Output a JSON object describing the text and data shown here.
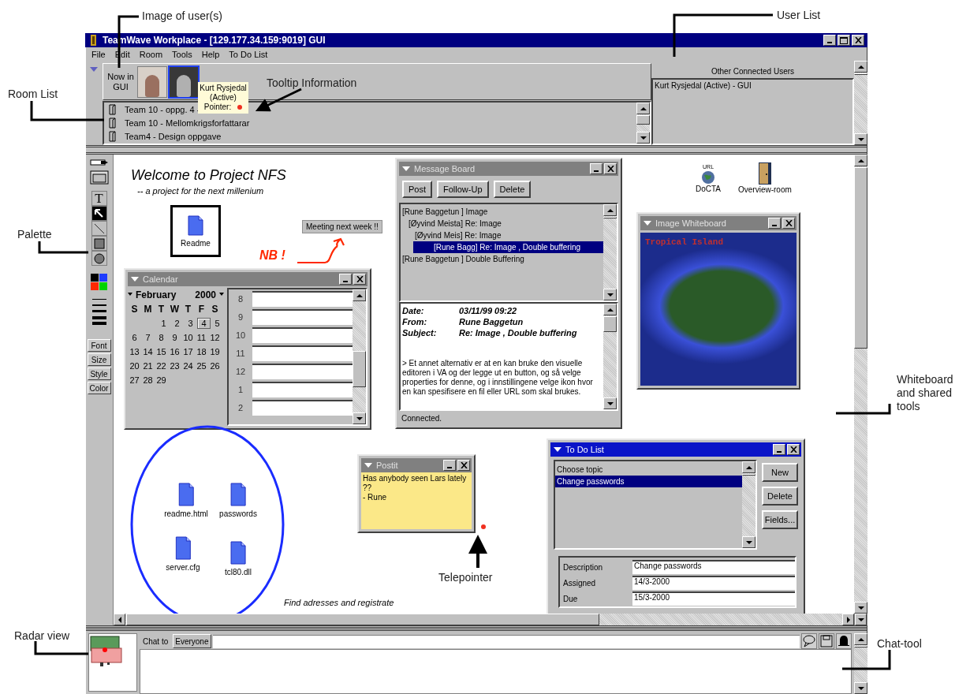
{
  "annotations": [
    {
      "text": "Image of user(s)"
    },
    {
      "text": "User List"
    },
    {
      "text": "Tooltip Information"
    },
    {
      "text": "Room List"
    },
    {
      "text": "Palette"
    },
    {
      "text": "Whiteboard and shared tools"
    },
    {
      "text": "Telepointer"
    },
    {
      "text": "Radar view"
    },
    {
      "text": "Chat-tool"
    }
  ],
  "window": {
    "title": "TeamWave Workplace - [129.177.34.159:9019] GUI"
  },
  "menu": [
    "File",
    "Edit",
    "Room",
    "Tools",
    "Help",
    "To Do List"
  ],
  "now_in": {
    "label": "Now in GUI",
    "users": [
      {
        "selected": false
      },
      {
        "selected": true
      }
    ]
  },
  "tooltip": {
    "name": "Kurt Rysjedal",
    "status": "(Active)",
    "pointer_label": "Pointer:"
  },
  "rooms": [
    "Team 10 - oppg. 4 -",
    "Team 10 - Mellomkrigsforfattarar",
    "Team4 - Design oppgave"
  ],
  "user_list": {
    "header": "Other Connected Users",
    "users": [
      "Kurt Rysjedal (Active) - GUI"
    ]
  },
  "palette": {
    "tools": [
      {
        "kind": "text",
        "label": "T",
        "selected": false
      },
      {
        "kind": "arrow",
        "selected": true
      },
      {
        "kind": "line",
        "selected": false
      },
      {
        "kind": "rect",
        "selected": false
      },
      {
        "kind": "oval",
        "selected": false
      }
    ],
    "colors": [
      {
        "color": "#000000"
      },
      {
        "color": "#1e3cff"
      },
      {
        "color": "#ff2800"
      },
      {
        "color": "#00d400"
      }
    ],
    "buttons": [
      "Font",
      "Size",
      "Style",
      "Color"
    ]
  },
  "whiteboard": {
    "title": "Welcome to Project NFS",
    "subtitle": "-- a project for the next millenium",
    "readme": "Readme",
    "note_button": "Meeting next week !!",
    "nb": "NB !",
    "calendar": {
      "title": "Calendar",
      "active": false,
      "month": "February",
      "year": "2000",
      "weekdays": [
        "S",
        "M",
        "T",
        "W",
        "T",
        "F",
        "S"
      ],
      "weeks": [
        [
          {
            "day": "1",
            "selected": false
          },
          {
            "day": "2",
            "selected": false
          },
          {
            "day": "3",
            "selected": false
          },
          {
            "day": "4",
            "selected": true
          },
          {
            "day": "5",
            "selected": false
          }
        ],
        [
          {
            "day": "6",
            "selected": false
          },
          {
            "day": "7",
            "selected": false
          },
          {
            "day": "8",
            "selected": false
          },
          {
            "day": "9",
            "selected": false
          },
          {
            "day": "10",
            "selected": false
          },
          {
            "day": "11",
            "selected": false
          },
          {
            "day": "12",
            "selected": false
          }
        ],
        [
          {
            "day": "13",
            "selected": false
          },
          {
            "day": "14",
            "selected": false
          },
          {
            "day": "15",
            "selected": false
          },
          {
            "day": "16",
            "selected": false
          },
          {
            "day": "17",
            "selected": false
          },
          {
            "day": "18",
            "selected": false
          },
          {
            "day": "19",
            "selected": false
          }
        ],
        [
          {
            "day": "20",
            "selected": false
          },
          {
            "day": "21",
            "selected": false
          },
          {
            "day": "22",
            "selected": false
          },
          {
            "day": "23",
            "selected": false
          },
          {
            "day": "24",
            "selected": false
          },
          {
            "day": "25",
            "selected": false
          },
          {
            "day": "26",
            "selected": false
          }
        ],
        [
          {
            "day": "27",
            "selected": false
          },
          {
            "day": "28",
            "selected": false
          },
          {
            "day": "29",
            "selected": false
          }
        ]
      ],
      "hours": [
        "8",
        "9",
        "10",
        "11",
        "12",
        "1",
        "2"
      ]
    },
    "message_board": {
      "title": "Message Board",
      "active": false,
      "buttons": [
        "Post",
        "Follow-Up",
        "Delete"
      ],
      "threads": [
        {
          "text": "[Rune Baggetun  ] Image",
          "selected": false,
          "children": [
            {
              "text": "[Øyvind Meista] Re: Image",
              "selected": false,
              "children": [
                {
                  "text": "[Øyvind Meis] Re: Image",
                  "selected": false,
                  "children": [
                    {
                      "text": "[Rune Bagg] Re: Image , Double buffering",
                      "selected": true
                    }
                  ]
                }
              ]
            }
          ]
        },
        {
          "text": "[Rune Baggetun  ] Double Buffering",
          "selected": false
        }
      ],
      "headers": [
        {
          "label": "Date:",
          "value": "03/11/99 09:22"
        },
        {
          "label": "From:",
          "value": "Rune Baggetun"
        },
        {
          "label": "Subject:",
          "value": "Re: Image , Double buffering"
        }
      ],
      "body": "> Et annet alternativ er at en kan bruke den visuelle editoren i VA og der legge ut en button, og så velge properties for denne, og i innstillingene velge ikon hvor en kan spesifisere en fil eller URL som skal brukes.",
      "status": "Connected."
    },
    "links": [
      {
        "kind": "url",
        "badge": "URL",
        "label": "DoCTA"
      },
      {
        "kind": "room",
        "label": "Overview-room"
      }
    ],
    "image_whiteboard": {
      "title": "Image Whiteboard",
      "active": false,
      "caption": "Tropical Island"
    },
    "files": [
      "readme.html",
      "passwords",
      "server.cfg",
      "tcl80.dll"
    ],
    "postit": {
      "title": "Postit",
      "active": false,
      "lines": [
        "Has anybody seen Lars lately",
        "??",
        "- Rune"
      ]
    },
    "note": "Find adresses and registrate",
    "todo": {
      "title": "To Do List",
      "active": true,
      "items": [
        {
          "text": "Choose topic",
          "selected": false
        },
        {
          "text": "Change passwords",
          "selected": true
        }
      ],
      "buttons": [
        "New",
        "Delete",
        "Fields..."
      ],
      "fields": [
        {
          "label": "Description",
          "value": "Change passwords"
        },
        {
          "label": "Assigned",
          "value": "14/3-2000"
        },
        {
          "label": "Due",
          "value": "15/3-2000"
        }
      ]
    }
  },
  "chat": {
    "label": "Chat to",
    "recipient": "Everyone"
  }
}
